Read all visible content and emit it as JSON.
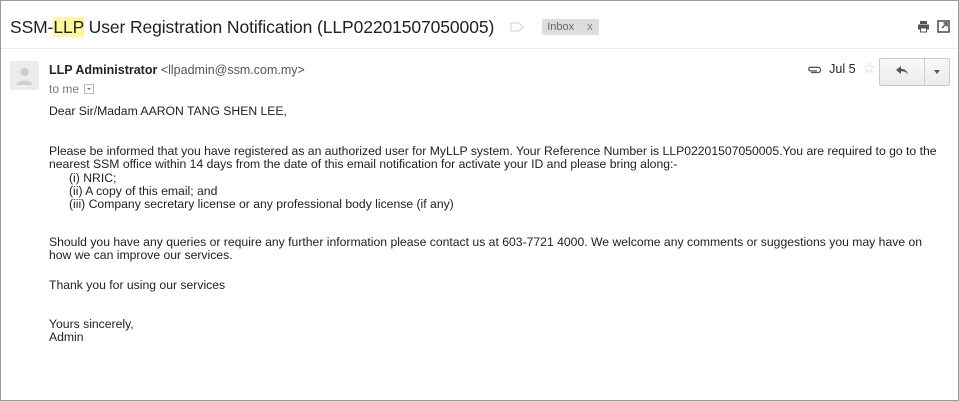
{
  "email": {
    "subject_prefix": "SSM-",
    "subject_highlight": "LLP",
    "subject_rest": " User Registration Notification (LLP02201507050005)",
    "label_chip": "Inbox",
    "label_chip_close": "x",
    "sender_name": "LLP Administrator",
    "sender_email": "<llpadmin@ssm.com.my>",
    "to_text": "to me",
    "date": "Jul 5",
    "star": "☆",
    "body": {
      "greeting": "Dear Sir/Madam AARON TANG SHEN LEE,",
      "para1": "Please be informed that you have registered as an authorized user for MyLLP system. Your Reference Number is LLP02201507050005.You are required to go to the nearest SSM office within 14 days from the date of this email notification for activate your ID and please bring along:-",
      "items": [
        "(i) NRIC;",
        "(ii) A copy of this email; and",
        "(iii) Company secretary license or any professional body license (if any)"
      ],
      "para2": "Should you have any queries or require any further information please contact us at 603-7721 4000. We welcome any comments or suggestions you may have on how we can improve our services.",
      "thanks": "Thank you for using our services",
      "closing": "Yours sincerely,",
      "signature": "Admin"
    }
  },
  "icons": {
    "label": "label-outline-icon",
    "print": "print-icon",
    "popout": "new-window-icon",
    "avatar": "default-avatar-icon",
    "attachment": "paperclip-icon",
    "reply": "reply-arrow-icon",
    "more": "chevron-down-icon"
  },
  "colors": {
    "highlight": "#fff79a",
    "chip_bg": "#dddddd",
    "border": "#9a9a9a"
  }
}
